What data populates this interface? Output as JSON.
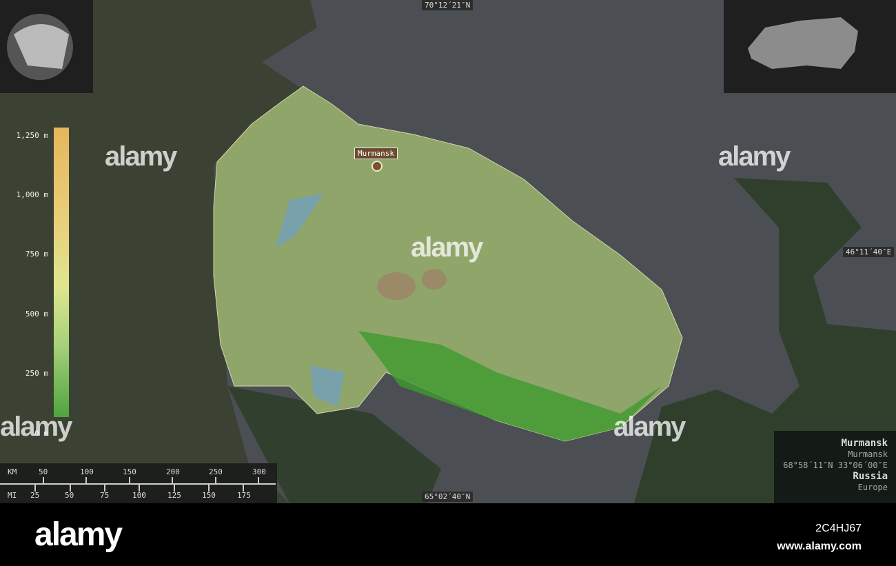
{
  "map": {
    "coords": {
      "top": "70°12´21″N",
      "bottom": "65°02´40″N",
      "right": "46°11´40″E"
    },
    "city": {
      "label": "Murmansk"
    },
    "legend": {
      "labels": [
        "1,250 m",
        "1,000 m",
        "750 m",
        "500 m",
        "250 m",
        "0 m"
      ],
      "colors": [
        "#e6b65c",
        "#dfe68f",
        "#4fa43e"
      ]
    },
    "scale": {
      "km_unit": "KM",
      "km_ticks": [
        "50",
        "100",
        "150",
        "200",
        "250",
        "300"
      ],
      "mi_unit": "MI",
      "mi_ticks": [
        "25",
        "50",
        "75",
        "100",
        "125",
        "150",
        "175"
      ]
    },
    "info": {
      "name": "Murmansk",
      "region": "Murmansk",
      "coordinates": "68°58´11″N 33°06´00″E",
      "country": "Russia",
      "continent": "Europe"
    },
    "watermark": "alamy"
  },
  "footer": {
    "logo": "alamy",
    "image_id": "2C4HJ67",
    "url": "www.alamy.com"
  }
}
